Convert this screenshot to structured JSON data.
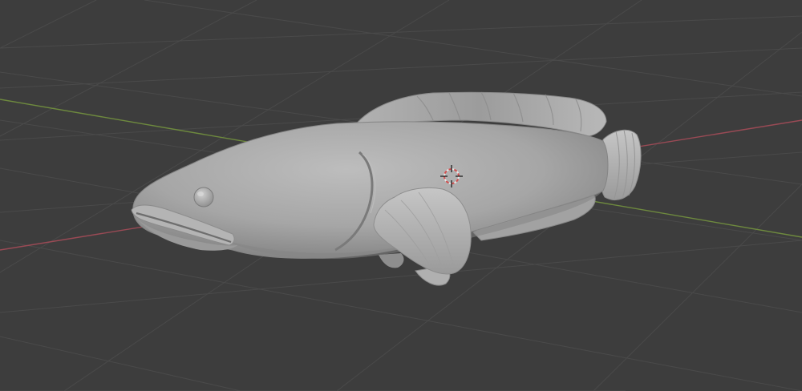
{
  "viewport": {
    "background_color": "#3d3d3d",
    "grid_color": "#4a4a4a",
    "x_axis_color": "#9a4a55",
    "y_axis_color": "#6e8a3e",
    "mesh_color": "#a8a8a8",
    "mesh_shadow_color": "#7e7e7e",
    "mesh_highlight_color": "#c4c4c4",
    "cursor_color_primary": "#e6e6e6",
    "cursor_color_secondary": "#d05050",
    "object": "fish-mesh",
    "shading_mode": "solid"
  }
}
